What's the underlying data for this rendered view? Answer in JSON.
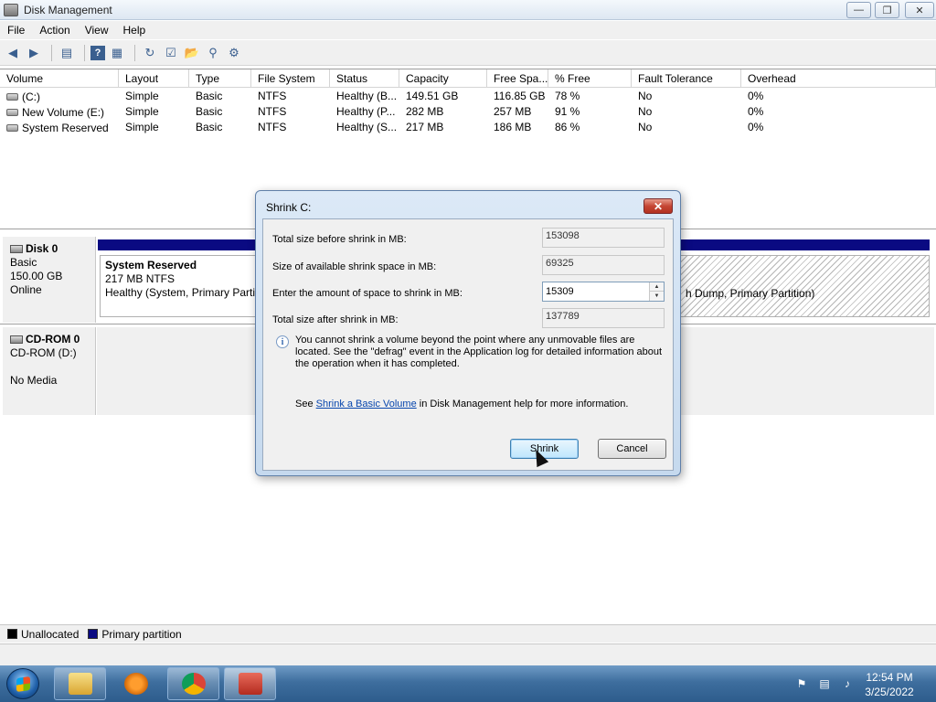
{
  "window": {
    "title": "Disk Management"
  },
  "menu": [
    "File",
    "Action",
    "View",
    "Help"
  ],
  "volume_list": {
    "columns": [
      "Volume",
      "Layout",
      "Type",
      "File System",
      "Status",
      "Capacity",
      "Free Spa...",
      "% Free",
      "Fault Tolerance",
      "Overhead"
    ],
    "rows": [
      [
        "(C:)",
        "Simple",
        "Basic",
        "NTFS",
        "Healthy (B...",
        "149.51 GB",
        "116.85 GB",
        "78 %",
        "No",
        "0%"
      ],
      [
        "New Volume (E:)",
        "Simple",
        "Basic",
        "NTFS",
        "Healthy (P...",
        "282 MB",
        "257 MB",
        "91 %",
        "No",
        "0%"
      ],
      [
        "System Reserved",
        "Simple",
        "Basic",
        "NTFS",
        "Healthy (S...",
        "217 MB",
        "186 MB",
        "86 %",
        "No",
        "0%"
      ]
    ]
  },
  "disks": {
    "disk0": {
      "name": "Disk 0",
      "type": "Basic",
      "size": "150.00 GB",
      "state": "Online",
      "partition_name": "System Reserved",
      "partition_size": "217 MB NTFS",
      "partition_status": "Healthy (System, Primary Partiti",
      "partition2_status": "h Dump, Primary Partition)"
    },
    "cdrom0": {
      "name": "CD-ROM 0",
      "drive": "CD-ROM (D:)",
      "media": "No Media"
    }
  },
  "legend": {
    "unallocated": "Unallocated",
    "primary": "Primary partition"
  },
  "dialog": {
    "title": "Shrink C:",
    "label_total_before": "Total size before shrink in MB:",
    "value_total_before": "153098",
    "label_available": "Size of available shrink space in MB:",
    "value_available": "69325",
    "label_amount": "Enter the amount of space to shrink in MB:",
    "value_amount": "15309",
    "label_total_after": "Total size after shrink in MB:",
    "value_total_after": "137789",
    "info": "You cannot shrink a volume beyond the point where any unmovable files are located. See the \"defrag\" event in the Application log for detailed information about the operation when it has completed.",
    "help_prefix": "See ",
    "help_link": "Shrink a Basic Volume",
    "help_suffix": " in Disk Management help for more information.",
    "shrink_button": "Shrink",
    "cancel_button": "Cancel"
  },
  "taskbar": {
    "time": "12:54 PM",
    "date": "3/25/2022"
  },
  "colors": {
    "primary_partition": "#0a0a82",
    "unallocated": "#000000"
  }
}
